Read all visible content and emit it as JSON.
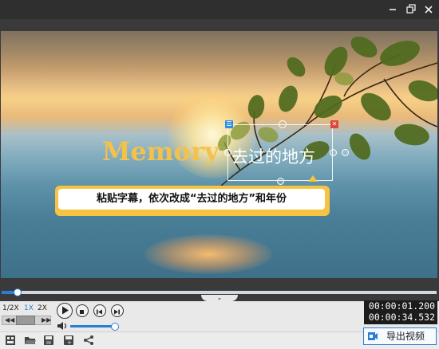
{
  "window": {
    "minimize_icon": "minimize-icon",
    "restore_icon": "restore-icon",
    "close_icon": "close-icon"
  },
  "video": {
    "logo_text": "Memory",
    "caption_text": "去过的地方",
    "tooltip": "粘贴字幕，依次改成“去过的地方”和年份"
  },
  "timeline": {
    "progress_fraction": 0.035,
    "collapse_icon": "chevron-down-icon"
  },
  "controls": {
    "speeds": [
      "1/2X",
      "1X",
      "2X"
    ],
    "active_speed": "1X",
    "volume_fraction": 1.0,
    "accent": "#2a7fd4",
    "current_time": "00:00:01.200",
    "total_time": "00:00:34.532"
  },
  "toolbar": {
    "icons": [
      "new-project-icon",
      "open-folder-icon",
      "save-icon",
      "save-as-icon",
      "share-icon"
    ],
    "export_label": "导出视频"
  }
}
